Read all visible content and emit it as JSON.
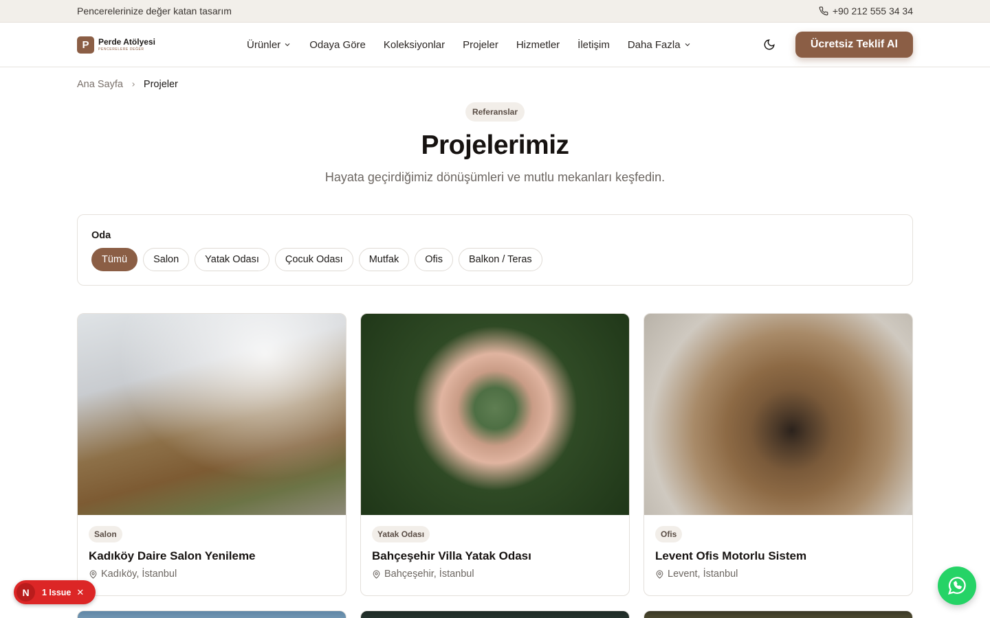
{
  "topbar": {
    "tagline": "Pencerelerinize değer katan tasarım",
    "phone": "+90 212 555 34 34"
  },
  "brand": {
    "letter": "P",
    "name": "Perde Atölyesi",
    "tag": "PENCERELERE DEĞER"
  },
  "nav": {
    "items": [
      {
        "label": "Ürünler",
        "dropdown": true
      },
      {
        "label": "Odaya Göre",
        "dropdown": false
      },
      {
        "label": "Koleksiyonlar",
        "dropdown": false
      },
      {
        "label": "Projeler",
        "dropdown": false
      },
      {
        "label": "Hizmetler",
        "dropdown": false
      },
      {
        "label": "İletişim",
        "dropdown": false
      },
      {
        "label": "Daha Fazla",
        "dropdown": true
      }
    ],
    "cta": "Ücretsiz Teklif Al"
  },
  "breadcrumb": {
    "home": "Ana Sayfa",
    "current": "Projeler"
  },
  "hero": {
    "badge": "Referanslar",
    "title": "Projelerimiz",
    "subtitle": "Hayata geçirdiğimiz dönüşümleri ve mutlu mekanları keşfedin."
  },
  "filter": {
    "label": "Oda",
    "chips": [
      "Tümü",
      "Salon",
      "Yatak Odası",
      "Çocuk Odası",
      "Mutfak",
      "Ofis",
      "Balkon / Teras"
    ],
    "active": "Tümü"
  },
  "projects": [
    {
      "tag": "Salon",
      "title": "Kadıköy Daire Salon Yenileme",
      "location": "Kadıköy, İstanbul"
    },
    {
      "tag": "Yatak Odası",
      "title": "Bahçeşehir Villa Yatak Odası",
      "location": "Bahçeşehir, İstanbul"
    },
    {
      "tag": "Ofis",
      "title": "Levent Ofis Motorlu Sistem",
      "location": "Levent, İstanbul"
    }
  ],
  "devtools": {
    "letter": "N",
    "issues": "1 Issue"
  },
  "colors": {
    "accent": "#8b5e45",
    "whatsapp": "#25d366",
    "issue": "#dc2626"
  }
}
